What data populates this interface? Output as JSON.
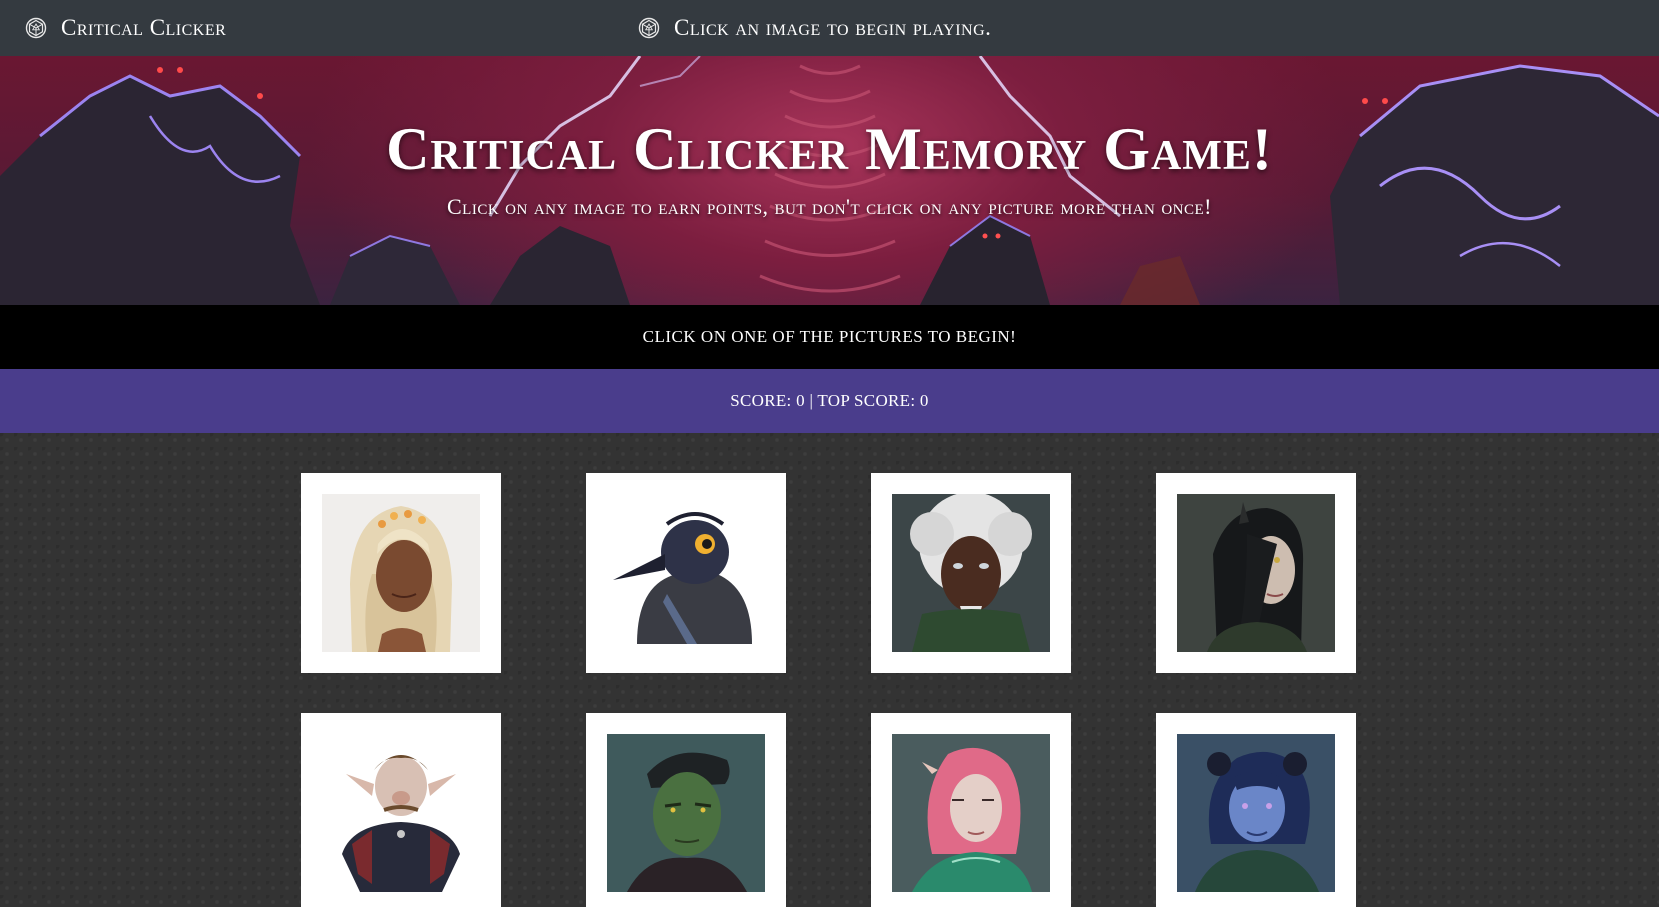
{
  "navbar": {
    "brand": "Critical Clicker",
    "status": "Click an image to begin playing.",
    "logo_icon": "critical-role-logo-icon"
  },
  "hero": {
    "title": "Critical Clicker Memory Game!",
    "subtitle": "Click on any image to earn points, but don't click on any picture more than once!"
  },
  "message": "CLICK ON ONE OF THE PICTURES TO BEGIN!",
  "score": {
    "text": "SCORE: 0 | TOP SCORE: 0",
    "score": 0,
    "top_score": 0
  },
  "cards": [
    {
      "name": "card-portrait-1",
      "subject": "blonde-elf-woman-portrait"
    },
    {
      "name": "card-portrait-2",
      "subject": "hooded-crow-portrait"
    },
    {
      "name": "card-portrait-3",
      "subject": "white-haired-elder-portrait"
    },
    {
      "name": "card-portrait-4",
      "subject": "dark-haired-horned-woman-portrait"
    },
    {
      "name": "card-portrait-5",
      "subject": "gnome-noble-portrait"
    },
    {
      "name": "card-portrait-6",
      "subject": "green-half-orc-portrait"
    },
    {
      "name": "card-portrait-7",
      "subject": "pink-haired-woman-portrait"
    },
    {
      "name": "card-portrait-8",
      "subject": "blue-tiefling-portrait"
    }
  ],
  "colors": {
    "navbar": "#343a40",
    "message_bar": "#000000",
    "score_bar": "#4a3d8c",
    "card": "#ffffff"
  }
}
